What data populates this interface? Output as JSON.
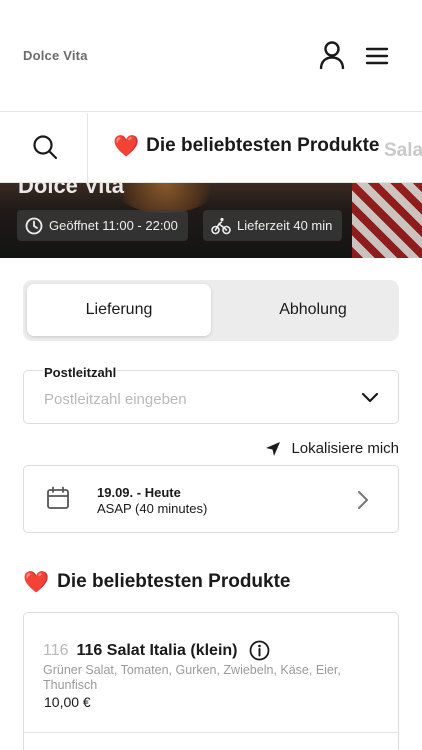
{
  "header": {
    "brand": "Dolce Vita",
    "icons": {
      "user": "user-icon",
      "menu": "hamburger-menu-icon"
    }
  },
  "category_bar": {
    "search_icon": "search-icon",
    "active": {
      "emoji": "❤️",
      "label": "Die beliebtesten Produkte"
    },
    "next_label": "Salat"
  },
  "hero": {
    "title": "Dolce Vita",
    "opening": {
      "icon": "clock-icon",
      "text": "Geöffnet 11:00 - 22:00"
    },
    "delivery": {
      "icon": "bike-icon",
      "text": "Lieferzeit 40 min"
    }
  },
  "order_mode": {
    "options": [
      "Lieferung",
      "Abholung"
    ],
    "selected": "Lieferung"
  },
  "zip": {
    "label": "Postleitzahl",
    "placeholder": "Postleitzahl eingeben",
    "value": ""
  },
  "locate": {
    "label": "Lokalisiere mich",
    "icon": "location-arrow-icon"
  },
  "schedule": {
    "date": "19.09. - Heute",
    "time": "ASAP (40 minutes)",
    "icon": "calendar-icon"
  },
  "section": {
    "emoji": "❤️",
    "title": "Die beliebtesten Produkte"
  },
  "products": [
    {
      "number": "116",
      "name": "116 Salat Italia (klein)",
      "description": "Grüner Salat, Tomaten, Gurken, Zwiebeln, Käse, Eier, Thunfisch",
      "price": "10,00 €"
    }
  ]
}
